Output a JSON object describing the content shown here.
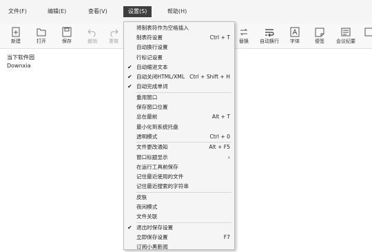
{
  "menubar": {
    "items": [
      "文件(F)",
      "编辑(E)",
      "查看(V)",
      "设置(S)",
      "帮助(H)"
    ],
    "active_index": 3
  },
  "toolbar": {
    "left": [
      {
        "label": "新建",
        "icon": "new-file-icon",
        "enabled": true
      },
      {
        "label": "打开",
        "icon": "open-folder-icon",
        "enabled": true
      },
      {
        "label": "保存",
        "icon": "save-icon",
        "enabled": true
      },
      {
        "label": "撤销",
        "icon": "undo-icon",
        "enabled": false
      },
      {
        "label": "重做",
        "icon": "redo-icon",
        "enabled": false
      }
    ],
    "right": [
      {
        "label": "替换",
        "icon": "replace-icon",
        "enabled": true
      },
      {
        "label": "自动换行",
        "icon": "word-wrap-icon",
        "enabled": true
      },
      {
        "label": "字体",
        "icon": "font-icon",
        "enabled": true
      },
      {
        "label": "便签",
        "icon": "sticky-note-icon",
        "enabled": true
      },
      {
        "label": "会议纪要",
        "icon": "meeting-notes-icon",
        "enabled": true
      }
    ]
  },
  "editor": {
    "lines": [
      "当下软件园",
      "Downxia"
    ]
  },
  "settings_menu": {
    "items": [
      {
        "label": "将制表符作为空格插入",
        "shortcut": "",
        "checked": false
      },
      {
        "label": "制表符设置",
        "shortcut": "Ctrl + T",
        "checked": false
      },
      {
        "label": "自动换行设置",
        "shortcut": "",
        "checked": false
      },
      {
        "label": "行标记设置",
        "shortcut": "",
        "checked": false
      },
      {
        "label": "自动缩进文本",
        "shortcut": "",
        "checked": true
      },
      {
        "label": "自动关闭HTML/XML",
        "shortcut": "Ctrl + Shift + H",
        "checked": true
      },
      {
        "label": "自动完成单词",
        "shortcut": "",
        "checked": true,
        "separator_after": true
      },
      {
        "label": "重用窗口",
        "shortcut": "",
        "checked": false
      },
      {
        "label": "保存窗口位置",
        "shortcut": "",
        "checked": false
      },
      {
        "label": "总在最前",
        "shortcut": "Alt + T",
        "checked": false
      },
      {
        "label": "最小化到系统托盘",
        "shortcut": "",
        "checked": false
      },
      {
        "label": "透明模式",
        "shortcut": "Ctrl + 0",
        "checked": false,
        "separator_after": true
      },
      {
        "label": "文件更改通知",
        "shortcut": "Alt + F5",
        "checked": false
      },
      {
        "label": "窗口标题显示",
        "shortcut": "",
        "checked": false,
        "submenu": true
      },
      {
        "label": "在运行工具前保存",
        "shortcut": "",
        "checked": false
      },
      {
        "label": "记住最近使用的文件",
        "shortcut": "",
        "checked": false
      },
      {
        "label": "记住最近搜索的字符串",
        "shortcut": "",
        "checked": false,
        "separator_after": true
      },
      {
        "label": "皮肤",
        "shortcut": "",
        "checked": false
      },
      {
        "label": "夜间模式",
        "shortcut": "",
        "checked": false
      },
      {
        "label": "文件关联",
        "shortcut": "",
        "checked": false,
        "separator_after": true
      },
      {
        "label": "退出时保存设置",
        "shortcut": "",
        "checked": true
      },
      {
        "label": "立即保存设置",
        "shortcut": "F7",
        "checked": false
      },
      {
        "label": "订阅小黑新闻",
        "shortcut": "",
        "checked": false
      }
    ]
  }
}
